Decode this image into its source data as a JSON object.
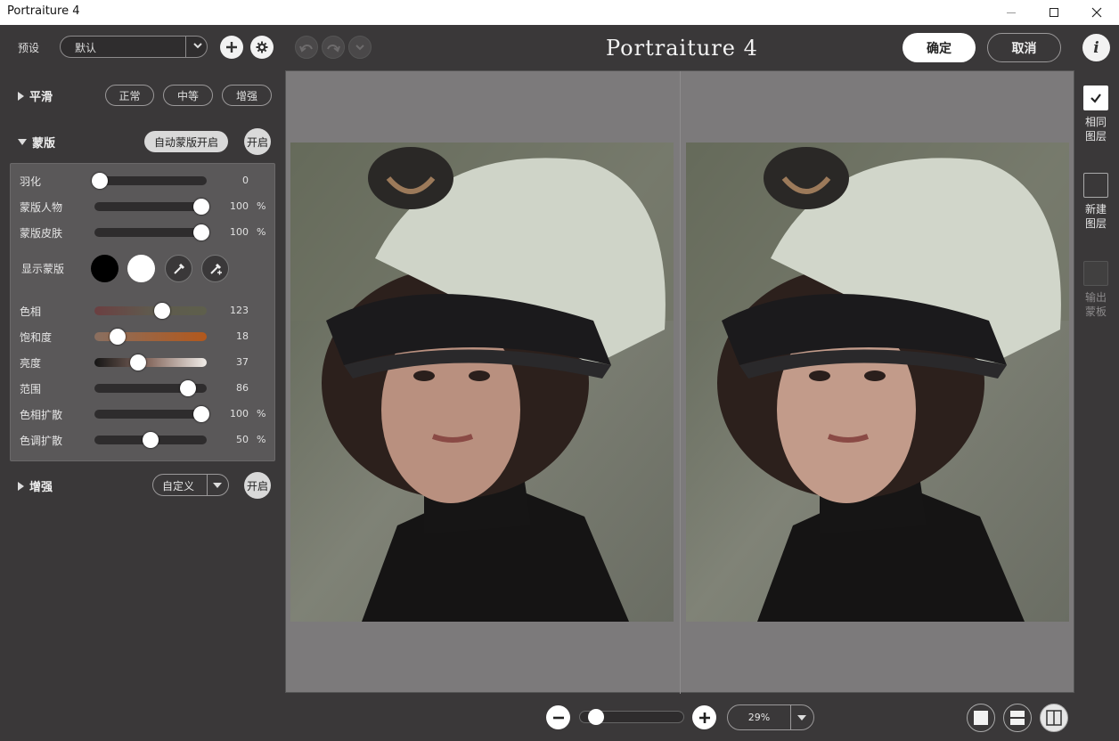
{
  "window": {
    "title": "Portraiture 4"
  },
  "toolbar": {
    "preset_label": "预设",
    "preset_value": "默认",
    "brand": "Portraiture 4",
    "ok_label": "确定",
    "cancel_label": "取消",
    "info_label": "i"
  },
  "smoothing": {
    "title": "平滑",
    "options": [
      "正常",
      "中等",
      "增强"
    ]
  },
  "mask": {
    "title": "蒙版",
    "auto_mask_label": "自动蒙版开启",
    "toggle_label": "开启",
    "show_mask_label": "显示蒙版",
    "sliders": [
      {
        "label": "羽化",
        "value": "0",
        "unit": "",
        "fraction": 0.05
      },
      {
        "label": "蒙版人物",
        "value": "100",
        "unit": "%",
        "fraction": 0.95
      },
      {
        "label": "蒙版皮肤",
        "value": "100",
        "unit": "%",
        "fraction": 0.95
      },
      {
        "label": "色相",
        "value": "123",
        "unit": "",
        "fraction": 0.6
      },
      {
        "label": "饱和度",
        "value": "18",
        "unit": "",
        "fraction": 0.21
      },
      {
        "label": "亮度",
        "value": "37",
        "unit": "",
        "fraction": 0.39
      },
      {
        "label": "范围",
        "value": "86",
        "unit": "",
        "fraction": 0.83
      },
      {
        "label": "色相扩散",
        "value": "100",
        "unit": "%",
        "fraction": 0.95
      },
      {
        "label": "色调扩散",
        "value": "50",
        "unit": "%",
        "fraction": 0.5
      }
    ]
  },
  "enhance": {
    "title": "增强",
    "preset_value": "自定义",
    "toggle_label": "开启"
  },
  "zoom": {
    "value": "29%",
    "slider_fraction": 0.15
  },
  "right_rail": [
    {
      "label": "相同图层",
      "checked": true,
      "enabled": true
    },
    {
      "label": "新建图层",
      "checked": false,
      "enabled": true
    },
    {
      "label": "输出蒙板",
      "checked": false,
      "enabled": false
    }
  ],
  "colors": {
    "accent": "#ffffff",
    "panel": "#3a3839",
    "canvas": "#7c7a7b"
  }
}
